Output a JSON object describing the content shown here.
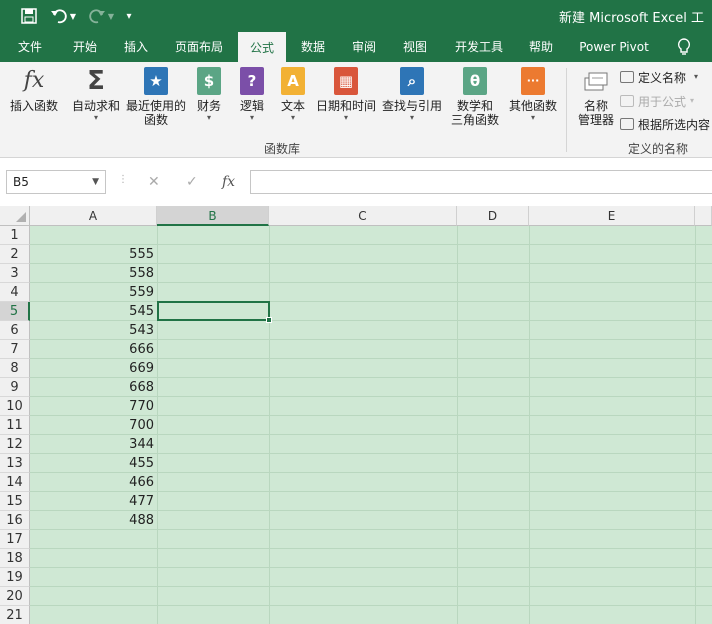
{
  "window": {
    "title": "新建 Microsoft Excel 工",
    "qat": {
      "save_icon": "save-icon",
      "undo_icon": "undo-icon",
      "redo_icon": "redo-icon",
      "customize_icon": "customize-qat-icon"
    }
  },
  "tabs": [
    "文件",
    "开始",
    "插入",
    "页面布局",
    "公式",
    "数据",
    "审阅",
    "视图",
    "开发工具",
    "帮助",
    "Power Pivot"
  ],
  "active_tab": "公式",
  "tell_me_icon": "lightbulb-icon",
  "ribbon": {
    "insert_function": {
      "label": "插入函数",
      "icon": "fx"
    },
    "autosum": {
      "label": "自动求和",
      "icon": "Σ"
    },
    "recent": {
      "label1": "最近使用的",
      "label2": "函数"
    },
    "financial": {
      "label": "财务"
    },
    "logical": {
      "label": "逻辑",
      "icon": "?"
    },
    "text": {
      "label": "文本",
      "icon": "A"
    },
    "datetime": {
      "label": "日期和时间"
    },
    "lookup": {
      "label": "查找与引用"
    },
    "math": {
      "label1": "数学和",
      "label2": "三角函数",
      "icon": "θ"
    },
    "more": {
      "label": "其他函数",
      "icon": "···"
    },
    "library_group": "函数库",
    "name_manager": {
      "label1": "名称",
      "label2": "管理器"
    },
    "define_name": "定义名称",
    "use_in_formula": "用于公式",
    "create_from_selection": "根据所选内容",
    "defined_names_group": "定义的名称"
  },
  "formula_bar": {
    "name_box": "B5",
    "cancel": "✕",
    "enter": "✓",
    "fx": "fx",
    "content": ""
  },
  "grid": {
    "columns": [
      "A",
      "B",
      "C",
      "D",
      "E"
    ],
    "selected_column": "B",
    "selected_row": 5,
    "rows": [
      "1",
      "2",
      "3",
      "4",
      "5",
      "6",
      "7",
      "8",
      "9",
      "10",
      "11",
      "12",
      "13",
      "14",
      "15",
      "16",
      "17",
      "18",
      "19",
      "20",
      "21"
    ],
    "column_a_values": [
      "",
      "555",
      "558",
      "559",
      "545",
      "543",
      "666",
      "669",
      "668",
      "770",
      "700",
      "344",
      "455",
      "466",
      "477",
      "488",
      "",
      "",
      "",
      "",
      ""
    ]
  }
}
